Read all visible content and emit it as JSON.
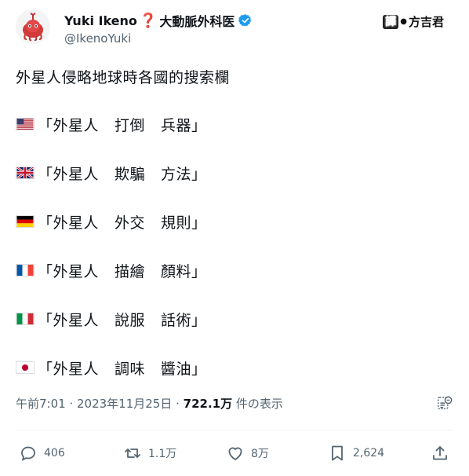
{
  "author": {
    "name": "Yuki Ikeno",
    "qmark": "❓",
    "title": "大動脈外科医",
    "handle": "@IkenoYuki"
  },
  "translator": {
    "badge": "譯",
    "dot": "●",
    "name": "方吉君"
  },
  "tweet": {
    "title": "外星人侵略地球時各國的搜索欄",
    "rows": [
      {
        "flag": "us",
        "word1": "「外星人",
        "word2": "打倒",
        "word3": "兵器」"
      },
      {
        "flag": "uk",
        "word1": "「外星人",
        "word2": "欺騙",
        "word3": "方法」"
      },
      {
        "flag": "de",
        "word1": "「外星人",
        "word2": "外交",
        "word3": "規則」"
      },
      {
        "flag": "fr",
        "word1": "「外星人",
        "word2": "描繪",
        "word3": "顏料」"
      },
      {
        "flag": "it",
        "word1": "「外星人",
        "word2": "說服",
        "word3": "話術」"
      },
      {
        "flag": "jp",
        "word1": "「外星人",
        "word2": "調味",
        "word3": "醬油」"
      }
    ]
  },
  "meta": {
    "time": "午前7:01 · 2023年11月25日 · ",
    "views": "722.1万",
    "views_label": " 件の表示"
  },
  "actions": {
    "replies": "406",
    "retweets": "1.1万",
    "likes": "8万",
    "bookmarks": "2,624"
  },
  "colors": {
    "verified": "#1d9bf0",
    "muted": "#536471",
    "text": "#0f1419"
  }
}
